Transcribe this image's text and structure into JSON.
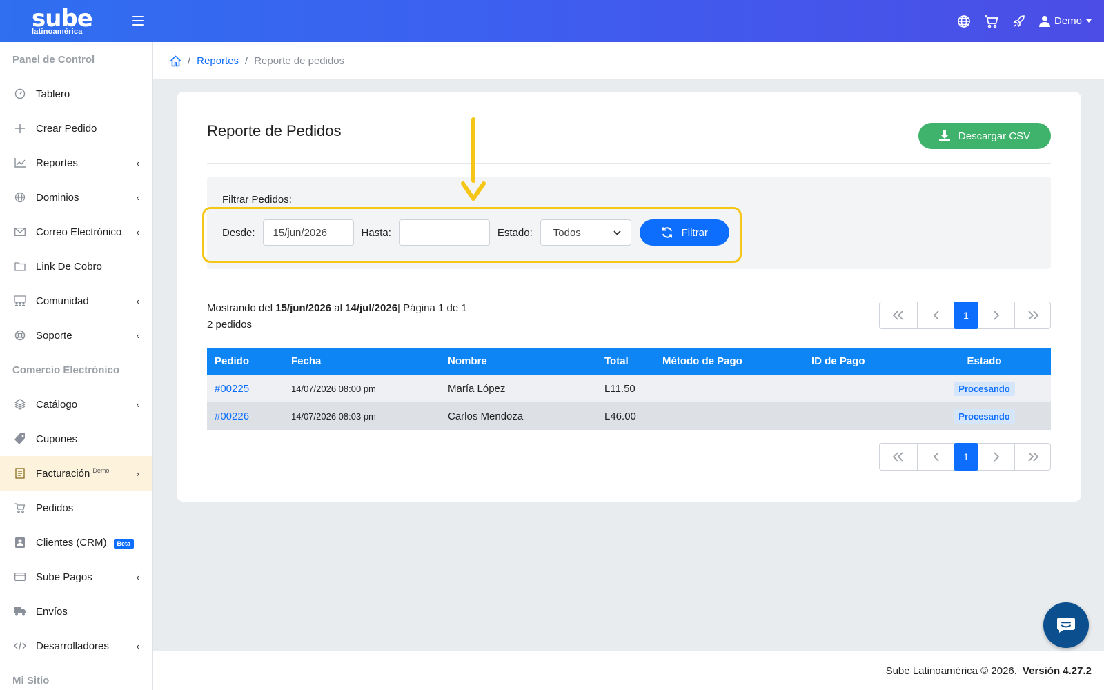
{
  "app": {
    "brand": "sube",
    "brand_sub": "latinoamérica",
    "user": "Demo"
  },
  "colors": {
    "primary": "#0d6efd",
    "success": "#3fb36b",
    "highlight": "#f5c518",
    "header_gradient_start": "#2f6ff0",
    "header_gradient_end": "#4b4de6"
  },
  "topbar": {
    "icons": [
      "globe-icon",
      "cart-icon",
      "rocket-icon",
      "user-icon"
    ]
  },
  "sidebar": {
    "sections": [
      {
        "title": "Panel de Control",
        "items": [
          {
            "label": "Tablero",
            "icon": "gauge-icon",
            "chevron": ""
          },
          {
            "label": "Crear Pedido",
            "icon": "plus-icon",
            "chevron": ""
          },
          {
            "label": "Reportes",
            "icon": "chart-line-icon",
            "chevron": "‹"
          },
          {
            "label": "Dominios",
            "icon": "globe-icon",
            "chevron": "‹"
          },
          {
            "label": "Correo Electrónico",
            "icon": "envelope-icon",
            "chevron": "‹"
          },
          {
            "label": "Link De Cobro",
            "icon": "folder-icon",
            "chevron": ""
          },
          {
            "label": "Comunidad",
            "icon": "people-icon",
            "chevron": "‹"
          },
          {
            "label": "Soporte",
            "icon": "lifebuoy-icon",
            "chevron": "‹"
          }
        ]
      },
      {
        "title": "Comercio Electrónico",
        "items": [
          {
            "label": "Catálogo",
            "icon": "layers-icon",
            "chevron": "‹"
          },
          {
            "label": "Cupones",
            "icon": "tag-icon",
            "chevron": ""
          },
          {
            "label": "Facturación",
            "icon": "receipt-icon",
            "chevron": "›",
            "sup": "Demo",
            "active": true
          },
          {
            "label": "Pedidos",
            "icon": "cart-icon",
            "chevron": ""
          },
          {
            "label": "Clientes (CRM)",
            "icon": "contact-icon",
            "chevron": "",
            "badge": "Beta"
          },
          {
            "label": "Sube Pagos",
            "icon": "card-icon",
            "chevron": "‹"
          },
          {
            "label": "Envíos",
            "icon": "truck-icon",
            "chevron": ""
          },
          {
            "label": "Desarrolladores",
            "icon": "code-icon",
            "chevron": "‹"
          }
        ]
      },
      {
        "title": "Mi Sitio",
        "items": []
      }
    ]
  },
  "breadcrumb": {
    "home_icon": "home-icon",
    "parent": "Reportes",
    "current": "Reporte de pedidos",
    "separator": "/"
  },
  "card": {
    "title": "Reporte de Pedidos",
    "download_label": "Descargar CSV"
  },
  "filter": {
    "title": "Filtrar Pedidos:",
    "from_label": "Desde:",
    "from_value": "15/jun/2026",
    "to_label": "Hasta:",
    "to_value": "",
    "status_label": "Estado:",
    "status_value": "Todos",
    "button_label": "Filtrar"
  },
  "summary": {
    "prefix": "Mostrando del",
    "from": "15/jun/2026",
    "middle": "al",
    "to": "14/jul/2026",
    "page_text": "| Página 1 de 1",
    "count": "2 pedidos"
  },
  "pagination": {
    "first": "«",
    "prev": "‹",
    "current": "1",
    "next": "›",
    "last": "»"
  },
  "table": {
    "headers": [
      "Pedido",
      "Fecha",
      "Nombre",
      "Total",
      "Método de Pago",
      "ID de Pago",
      "Estado"
    ],
    "rows": [
      {
        "order": "#00225",
        "date": "14/07/2026 08:00 pm",
        "name": "María López",
        "total": "L11.50",
        "method": "",
        "payment_id": "",
        "status": "Procesando"
      },
      {
        "order": "#00226",
        "date": "14/07/2026 08:03 pm",
        "name": "Carlos Mendoza",
        "total": "L46.00",
        "method": "",
        "payment_id": "",
        "status": "Procesando"
      }
    ]
  },
  "footer": {
    "copyright": "Sube Latinoamérica © 2026.",
    "version": "Versión 4.27.2"
  }
}
